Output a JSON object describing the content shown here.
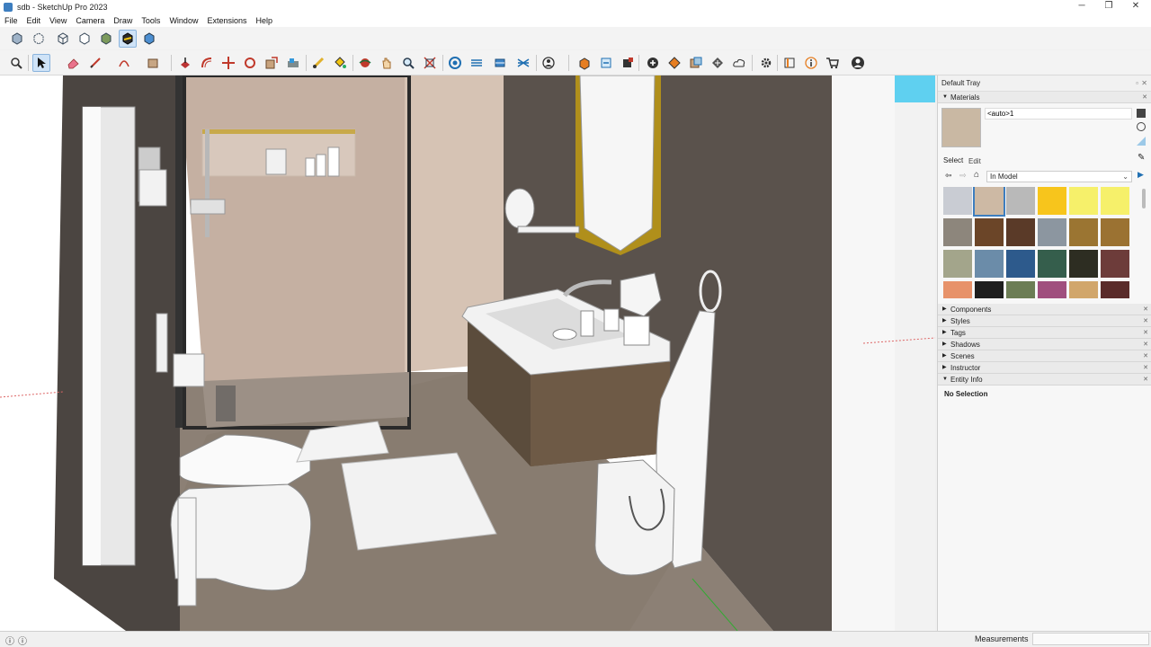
{
  "app": {
    "title": "sdb - SketchUp Pro 2023"
  },
  "window_controls": {
    "minimize": "─",
    "restore": "❐",
    "close": "✕"
  },
  "menu": [
    "File",
    "Edit",
    "View",
    "Camera",
    "Draw",
    "Tools",
    "Window",
    "Extensions",
    "Help"
  ],
  "toolbar_top": [
    {
      "name": "xray-style-icon"
    },
    {
      "name": "backedges-style-icon"
    },
    {
      "name": "wireframe-style-icon"
    },
    {
      "name": "hiddenline-style-icon"
    },
    {
      "name": "shaded-style-icon"
    },
    {
      "name": "shaded-textures-style-icon"
    },
    {
      "name": "monochrome-style-icon"
    }
  ],
  "toolbar_main": [
    "zoom-extents-icon",
    "select-tool-icon",
    "eraser-tool-icon",
    "line-tool-icon",
    "arc-tool-icon",
    "rectangle-tool-icon",
    "push-pull-tool-icon",
    "offset-tool-icon",
    "move-tool-icon",
    "rotate-tool-icon",
    "scale-tool-icon",
    "follow-me-tool-icon",
    "tape-measure-tool-icon",
    "paint-bucket-tool-icon",
    "orbit-tool-icon",
    "pan-tool-icon",
    "zoom-tool-icon",
    "zoom-window-icon",
    "section-plane-icon",
    "section-cut-icon",
    "section-fill-icon",
    "section-display-icon",
    "camera-position-icon",
    "components-icon",
    "3d-warehouse-icon",
    "extension-warehouse-icon",
    "layout-icon",
    "add-location-icon",
    "geo-location-icon",
    "photo-textures-icon",
    "sandbox-icon",
    "cloud-icon",
    "settings-icon",
    "ruby-console-icon",
    "info-icon",
    "cart-icon",
    "account-icon"
  ],
  "tray": {
    "title": "Default Tray",
    "materials": {
      "header": "Materials",
      "current_name": "<auto>1",
      "current_color": "#c9b8a3",
      "tabs": {
        "select": "Select",
        "edit": "Edit"
      },
      "collection": "In Model",
      "swatches": [
        "#c9ccd3",
        "#cdb9a4",
        "#b9b9b9",
        "#f7c51c",
        "#f6f06a",
        "#f6f06a",
        "#8d867c",
        "#6b4528",
        "#5a3a28",
        "#8c96a0",
        "#9b7532",
        "#9b7232",
        "#a3a58b",
        "#6b8ca9",
        "#2d5a8c",
        "#355e4c",
        "#2d2d22",
        "#6d3c3a",
        "#e7926a",
        "#1e1e1e",
        "#6c7d55",
        "#a04f7e",
        "#d1a66b",
        "#5a2b2a"
      ]
    },
    "panels": [
      "Components",
      "Styles",
      "Tags",
      "Shadows",
      "Scenes",
      "Instructor"
    ],
    "entity_info": {
      "header": "Entity Info",
      "value": "No Selection"
    }
  },
  "status": {
    "measurements_label": "Measurements"
  },
  "colors": {
    "accent": "#cfe3f7",
    "wall_dark": "#4a4440",
    "floor": "#8b7f72",
    "shower_wall": "#c8b5a6"
  }
}
